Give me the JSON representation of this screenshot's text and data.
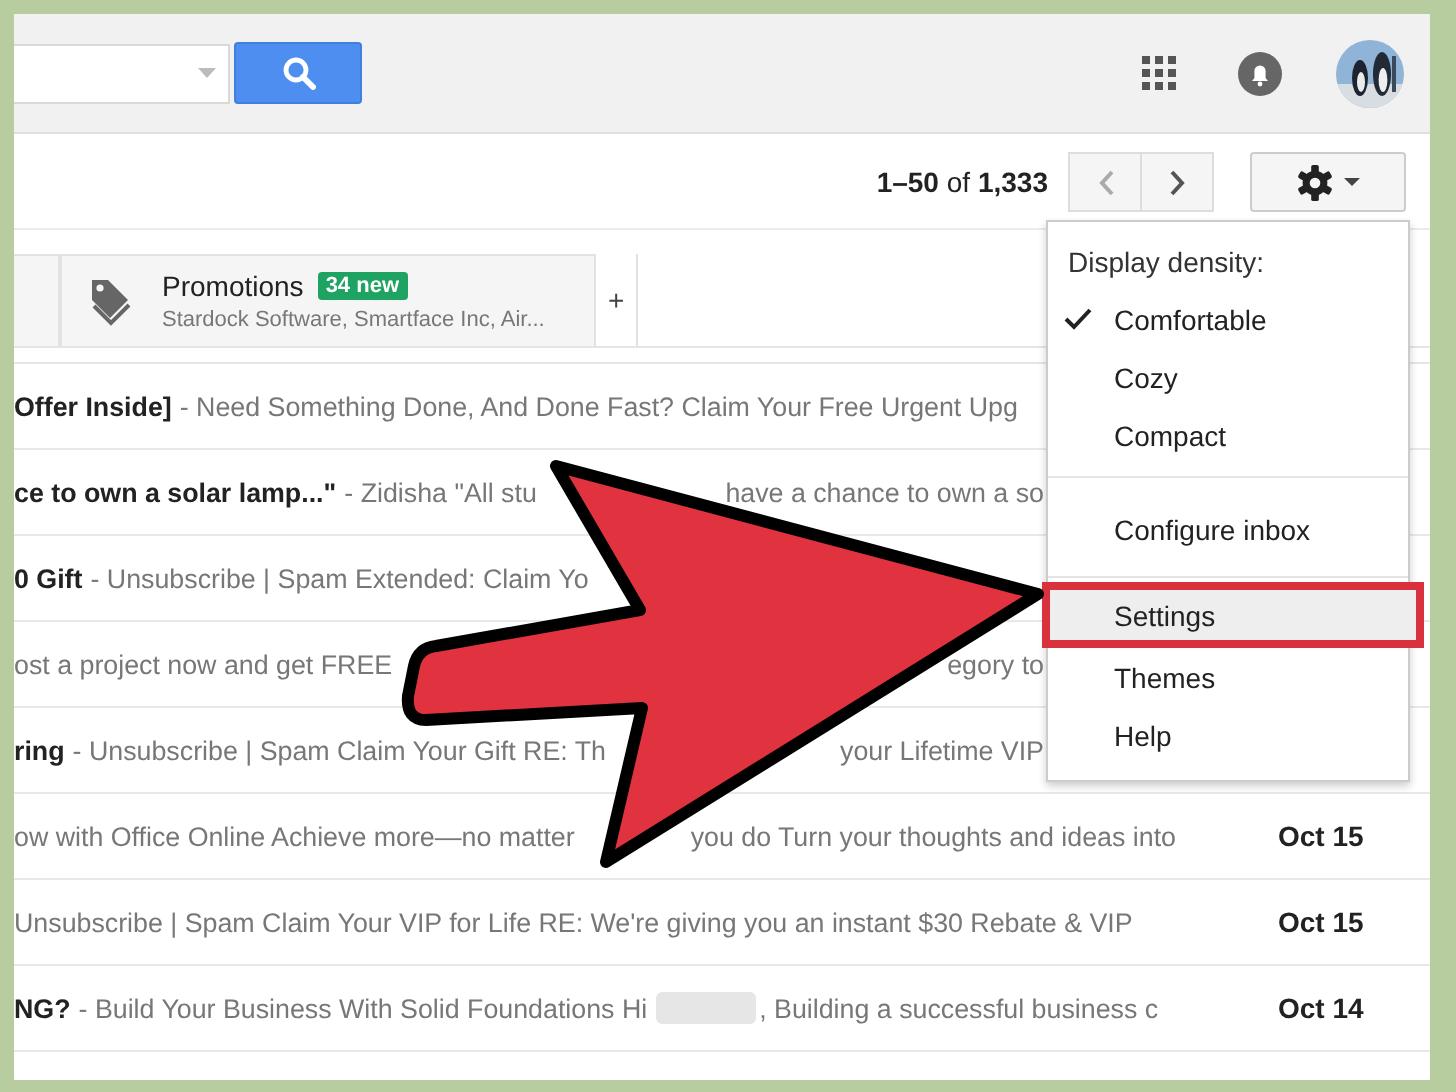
{
  "pagination": {
    "range": "**1–50** of **1,333**"
  },
  "tabs": [
    {
      "partial": true
    },
    {
      "label": "Promotions",
      "badge": "34 new",
      "senders": "Stardock Software, Smartface Inc, Air...",
      "partial": false
    }
  ],
  "add_tab": "+",
  "messages": [
    {
      "subject": "Offer Inside]",
      "parts": [
        {
          "kind": "text",
          "text": "- Need Something Done, And Done Fast? Claim Your Free Urgent Upg"
        }
      ]
    },
    {
      "subject": "ce to own a solar lamp...\"",
      "parts": [
        {
          "kind": "text",
          "text": "- Zidisha \"All stu"
        },
        {
          "kind": "hidden"
        },
        {
          "kind": "text",
          "text": "have a chance to own a so"
        }
      ]
    },
    {
      "subject": "0 Gift",
      "parts": [
        {
          "kind": "text",
          "text": "- Unsubscribe | Spam Extended: Claim Yo"
        },
        {
          "kind": "hidden"
        }
      ]
    },
    {
      "parts": [
        {
          "kind": "text",
          "text": "ost a project now and get FREE"
        },
        {
          "kind": "hidden"
        },
        {
          "kind": "text",
          "text": "egory to"
        }
      ]
    },
    {
      "subject": "ring",
      "parts": [
        {
          "kind": "text",
          "text": "- Unsubscribe | Spam Claim Your Gift RE: Th"
        },
        {
          "kind": "hidden"
        },
        {
          "kind": "text",
          "text": "your Lifetime VIP"
        }
      ]
    },
    {
      "parts": [
        {
          "kind": "text",
          "text": "ow with Office Online Achieve more—no matter"
        },
        {
          "kind": "hidden"
        },
        {
          "kind": "text",
          "text": "you do Turn your thoughts and ideas into"
        }
      ],
      "date": "Oct 15"
    },
    {
      "parts": [
        {
          "kind": "text",
          "text": "Unsubscribe | Spam Claim Your VIP for Life RE: We're giving you an instant $30 Rebate & VIP"
        }
      ],
      "date": "Oct 15"
    },
    {
      "subject": "NG?",
      "parts": [
        {
          "kind": "text",
          "text": "- Build Your Business With Solid Foundations Hi"
        },
        {
          "kind": "redacted"
        },
        {
          "kind": "text",
          "text": ", Building a successful business c"
        }
      ],
      "date": "Oct 14"
    }
  ],
  "settings_menu": [
    {
      "kind": "header",
      "label": "Display density:"
    },
    {
      "kind": "option",
      "label": "Comfortable",
      "checked": true
    },
    {
      "kind": "option",
      "label": "Cozy",
      "checked": false
    },
    {
      "kind": "option",
      "label": "Compact",
      "checked": false
    },
    {
      "kind": "action",
      "label": "Configure inbox",
      "divider_before": true,
      "highlighted": false
    },
    {
      "kind": "action",
      "label": "Settings",
      "divider_before": true,
      "highlighted": true
    },
    {
      "kind": "action",
      "label": "Themes",
      "divider_before": false,
      "highlighted": false
    },
    {
      "kind": "action",
      "label": "Help",
      "divider_before": false,
      "highlighted": false
    }
  ]
}
